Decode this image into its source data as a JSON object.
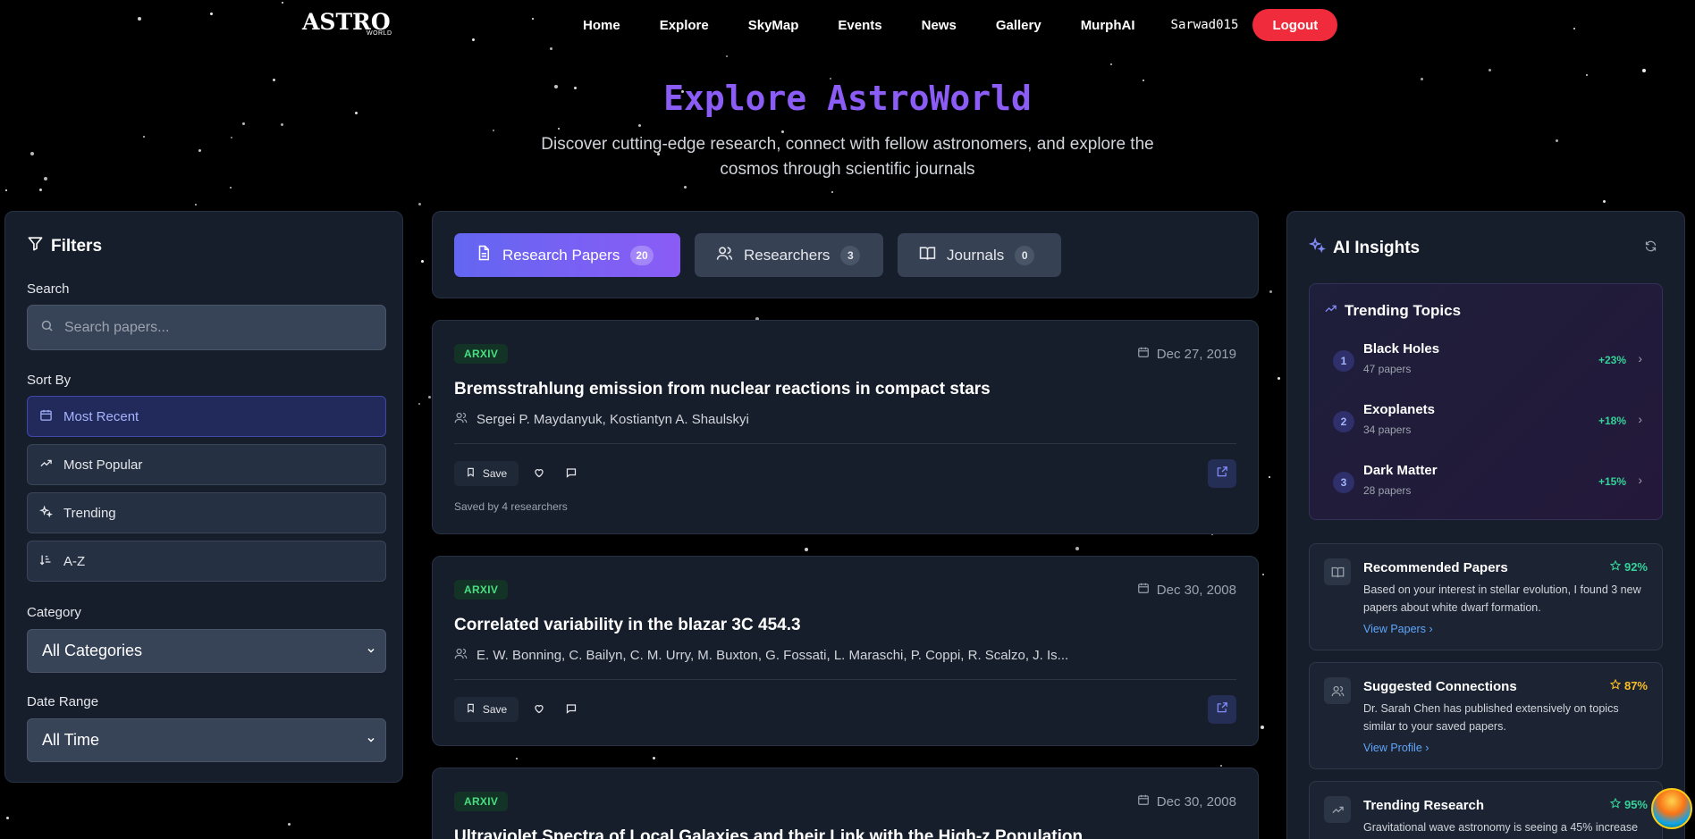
{
  "nav": {
    "logo": "ASTRO",
    "logo_sub": "WORLD",
    "links": [
      "Home",
      "Explore",
      "SkyMap",
      "Events",
      "News",
      "Gallery",
      "MurphAI"
    ],
    "username": "Sarwad015",
    "logout": "Logout"
  },
  "hero": {
    "title": "Explore AstroWorld",
    "subtitle": "Discover cutting-edge research, connect with fellow astronomers, and explore the cosmos through scientific journals"
  },
  "filters": {
    "title": "Filters",
    "search_label": "Search",
    "search_placeholder": "Search papers...",
    "sort_label": "Sort By",
    "sort_options": [
      "Most Recent",
      "Most Popular",
      "Trending",
      "A-Z"
    ],
    "category_label": "Category",
    "category_value": "All Categories",
    "date_label": "Date Range",
    "date_value": "All Time"
  },
  "tabs": [
    {
      "label": "Research Papers",
      "count": "20"
    },
    {
      "label": "Researchers",
      "count": "3"
    },
    {
      "label": "Journals",
      "count": "0"
    }
  ],
  "papers": [
    {
      "source": "ARXIV",
      "date": "Dec 27, 2019",
      "title": "Bremsstrahlung emission from nuclear reactions in compact stars",
      "authors": "Sergei P. Maydanyuk, Kostiantyn A. Shaulskyi",
      "save": "Save",
      "saved_by": "Saved by 4 researchers"
    },
    {
      "source": "ARXIV",
      "date": "Dec 30, 2008",
      "title": "Correlated variability in the blazar 3C 454.3",
      "authors": "E. W. Bonning, C. Bailyn, C. M. Urry, M. Buxton, G. Fossati, L. Maraschi, P. Coppi, R. Scalzo, J. Is...",
      "save": "Save"
    },
    {
      "source": "ARXIV",
      "date": "Dec 30, 2008",
      "title": "Ultraviolet Spectra of Local Galaxies and their Link with the High-z Population"
    }
  ],
  "insights": {
    "title": "AI Insights",
    "trending": {
      "title": "Trending Topics",
      "topics": [
        {
          "rank": "1",
          "name": "Black Holes",
          "count": "47 papers",
          "change": "+23%"
        },
        {
          "rank": "2",
          "name": "Exoplanets",
          "count": "34 papers",
          "change": "+18%"
        },
        {
          "rank": "3",
          "name": "Dark Matter",
          "count": "28 papers",
          "change": "+15%"
        }
      ]
    },
    "cards": [
      {
        "title": "Recommended Papers",
        "score": "92%",
        "score_color": "#34d399",
        "body": "Based on your interest in stellar evolution, I found 3 new papers about white dwarf formation.",
        "link": "View Papers"
      },
      {
        "title": "Suggested Connections",
        "score": "87%",
        "score_color": "#fbbf24",
        "body": "Dr. Sarah Chen has published extensively on topics similar to your saved papers.",
        "link": "View Profile"
      },
      {
        "title": "Trending Research",
        "score": "95%",
        "score_color": "#34d399",
        "body": "Gravitational wave astronomy is seeing a 45% increase"
      }
    ]
  },
  "colors": {
    "accent": "#8b5cf6",
    "logout": "#ef2b3c",
    "tab_active_start": "#6366f1",
    "tab_active_end": "#8b5cf6",
    "badge": "#4ade80",
    "positive": "#34d399"
  }
}
